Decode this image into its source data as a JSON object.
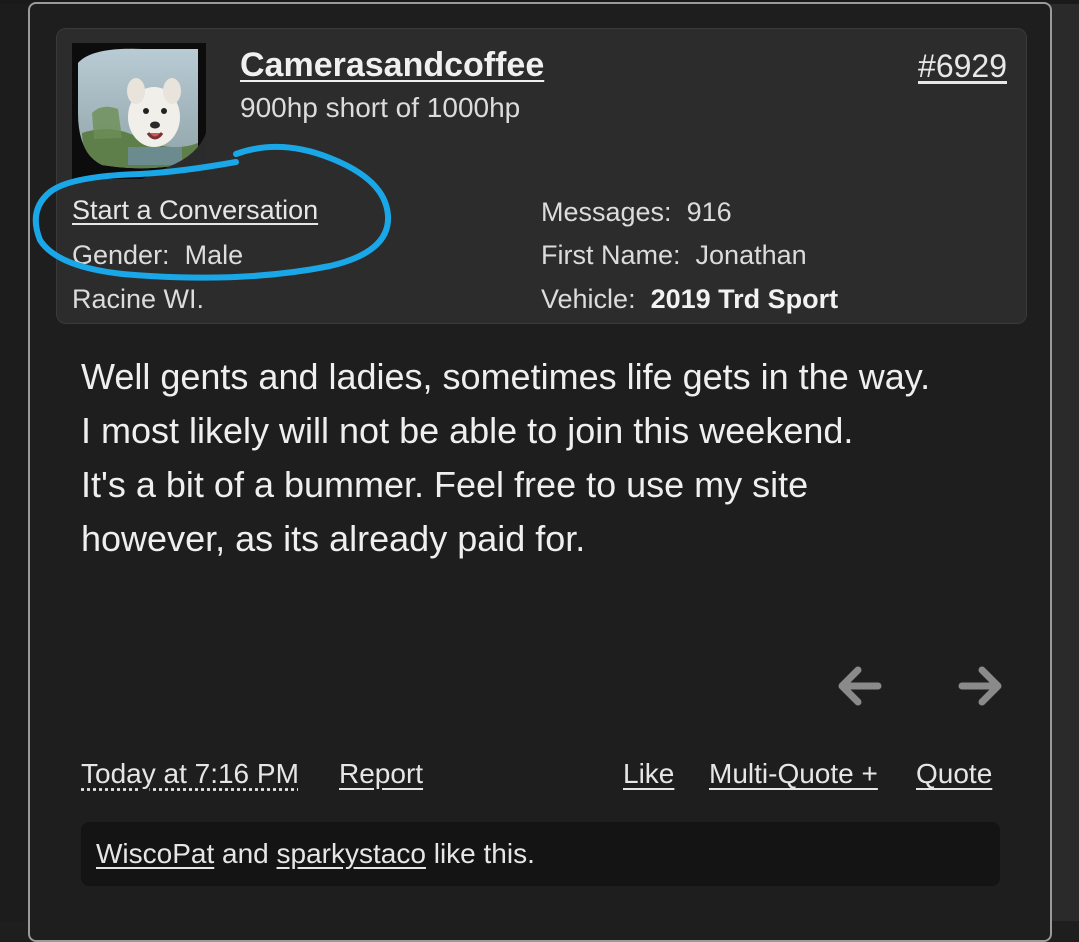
{
  "post": {
    "username": "Camerasandcoffee",
    "user_title": "900hp short of 1000hp",
    "post_number": "#6929",
    "start_conversation": "Start a Conversation",
    "gender_label": "Gender:",
    "gender_value": "Male",
    "location": "Racine WI.",
    "messages_label": "Messages:",
    "messages_value": "916",
    "first_name_label": "First Name:",
    "first_name_value": "Jonathan",
    "vehicle_label": "Vehicle:",
    "vehicle_value": "2019 Trd Sport",
    "message_lines": [
      "Well gents and ladies, sometimes life gets in the way.",
      "I most likely will not be able to join this weekend.",
      "It's a bit of a bummer. Feel free to use my site",
      "however, as its already paid for."
    ],
    "avatar_icon": "dog-in-car-mirror-avatar",
    "annotation_color": "#1aa7e8"
  },
  "nav": {
    "prev_icon": "arrow-left-icon",
    "next_icon": "arrow-right-icon"
  },
  "footer": {
    "timestamp": "Today at 7:16 PM",
    "report": "Report",
    "like": "Like",
    "multi_quote": "Multi-Quote +",
    "quote": "Quote"
  },
  "likes": {
    "user1": "WiscoPat",
    "and": "and",
    "user2": "sparkystaco",
    "suffix": "like this."
  }
}
